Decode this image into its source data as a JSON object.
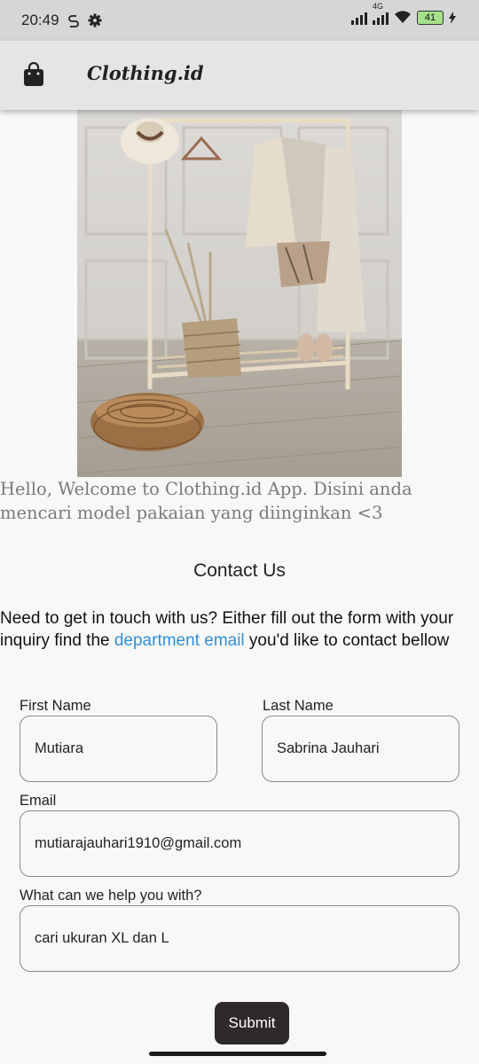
{
  "status_bar": {
    "time": "20:49",
    "network_type": "4G",
    "battery": "41"
  },
  "app": {
    "title": "Clothing.id"
  },
  "welcome_text": "Hello, Welcome to Clothing.id App. Disini anda mencari model pakaian yang diinginkan <3",
  "contact": {
    "heading": "Contact Us",
    "intro_before": "Need to get in touch with us? Either fill out the form with your inquiry find the ",
    "intro_link": "department email",
    "intro_after": " you'd like to contact bellow"
  },
  "form": {
    "first_name_label": "First Name",
    "first_name_value": "Mutiara",
    "last_name_label": "Last Name",
    "last_name_value": "Sabrina Jauhari",
    "email_label": "Email",
    "email_value": "mutiarajauhari1910@gmail.com",
    "help_label": "What can we help you with?",
    "help_value": "cari ukuran XL dan L",
    "submit_label": "Submit"
  },
  "colors": {
    "link": "#2f8fd6",
    "button": "#2e2a2a",
    "appbar": "#e5e5e5"
  }
}
